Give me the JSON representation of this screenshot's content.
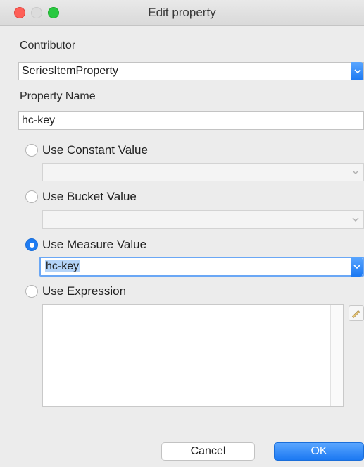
{
  "window": {
    "title": "Edit property"
  },
  "contributor": {
    "label": "Contributor",
    "value": "SeriesItemProperty"
  },
  "property_name": {
    "label": "Property Name",
    "value": "hc-key"
  },
  "options": {
    "constant": {
      "label": "Use Constant Value",
      "selected": false,
      "value": ""
    },
    "bucket": {
      "label": "Use Bucket Value",
      "selected": false,
      "value": ""
    },
    "measure": {
      "label": "Use Measure Value",
      "selected": true,
      "value": "hc-key"
    },
    "expression": {
      "label": "Use Expression",
      "selected": false,
      "value": ""
    }
  },
  "buttons": {
    "cancel": "Cancel",
    "ok": "OK"
  },
  "colors": {
    "accent": "#1f7cf2",
    "close": "#fe5f57",
    "maximize": "#28c840"
  }
}
